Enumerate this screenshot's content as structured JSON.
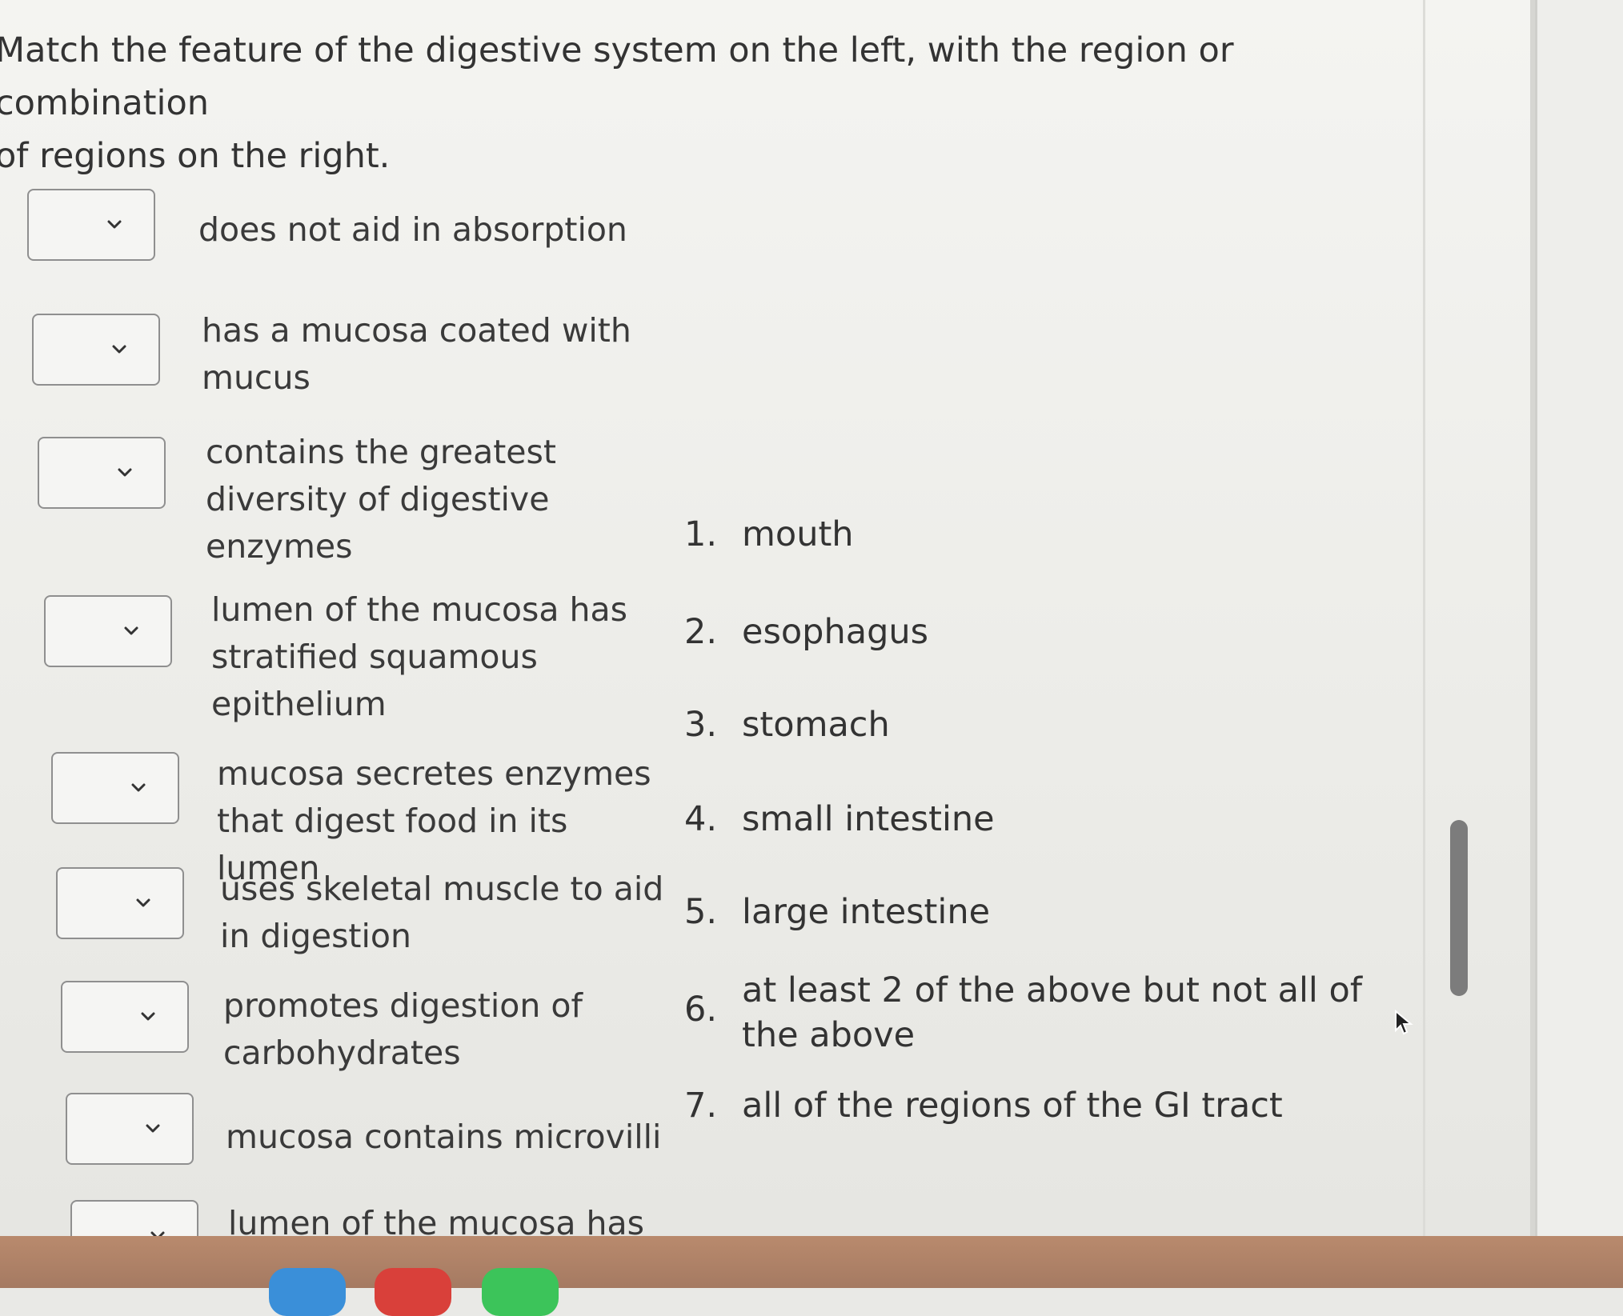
{
  "question": {
    "prompt_line1": "Match the feature of the digestive system on the left, with the region or combination",
    "prompt_line2": "of regions on the right."
  },
  "features": [
    {
      "lines": [
        "does not aid in absorption"
      ]
    },
    {
      "lines": [
        "has a mucosa coated with",
        "mucus"
      ]
    },
    {
      "lines": [
        "contains the greatest",
        "diversity of digestive",
        "enzymes"
      ]
    },
    {
      "lines": [
        "lumen of the mucosa has",
        "stratified squamous",
        "epithelium"
      ]
    },
    {
      "lines": [
        "mucosa secretes enzymes",
        "that digest food in its lumen"
      ]
    },
    {
      "lines": [
        "uses skeletal muscle to aid",
        "in digestion"
      ]
    },
    {
      "lines": [
        "promotes digestion of",
        "carbohydrates"
      ]
    },
    {
      "lines": [
        "mucosa contains microvilli"
      ]
    },
    {
      "lines": [
        "lumen of the mucosa has"
      ]
    }
  ],
  "options": [
    {
      "num": "1.",
      "lines": [
        "mouth"
      ]
    },
    {
      "num": "2.",
      "lines": [
        "esophagus"
      ]
    },
    {
      "num": "3.",
      "lines": [
        "stomach"
      ]
    },
    {
      "num": "4.",
      "lines": [
        "small intestine"
      ]
    },
    {
      "num": "5.",
      "lines": [
        "large intestine"
      ]
    },
    {
      "num": "6.",
      "lines": [
        "at least 2 of the above but not all of",
        "the above"
      ]
    },
    {
      "num": "7.",
      "lines": [
        "all of the regions of the GI tract"
      ]
    }
  ],
  "icons": {
    "dropdown": "chevron-down-icon",
    "cursor": "mouse-pointer-icon"
  },
  "colors": {
    "taskbar": "#b98a6d",
    "dock_blue": "#3a8fd9",
    "dock_red": "#d9403a",
    "dock_green": "#3cc45a"
  }
}
